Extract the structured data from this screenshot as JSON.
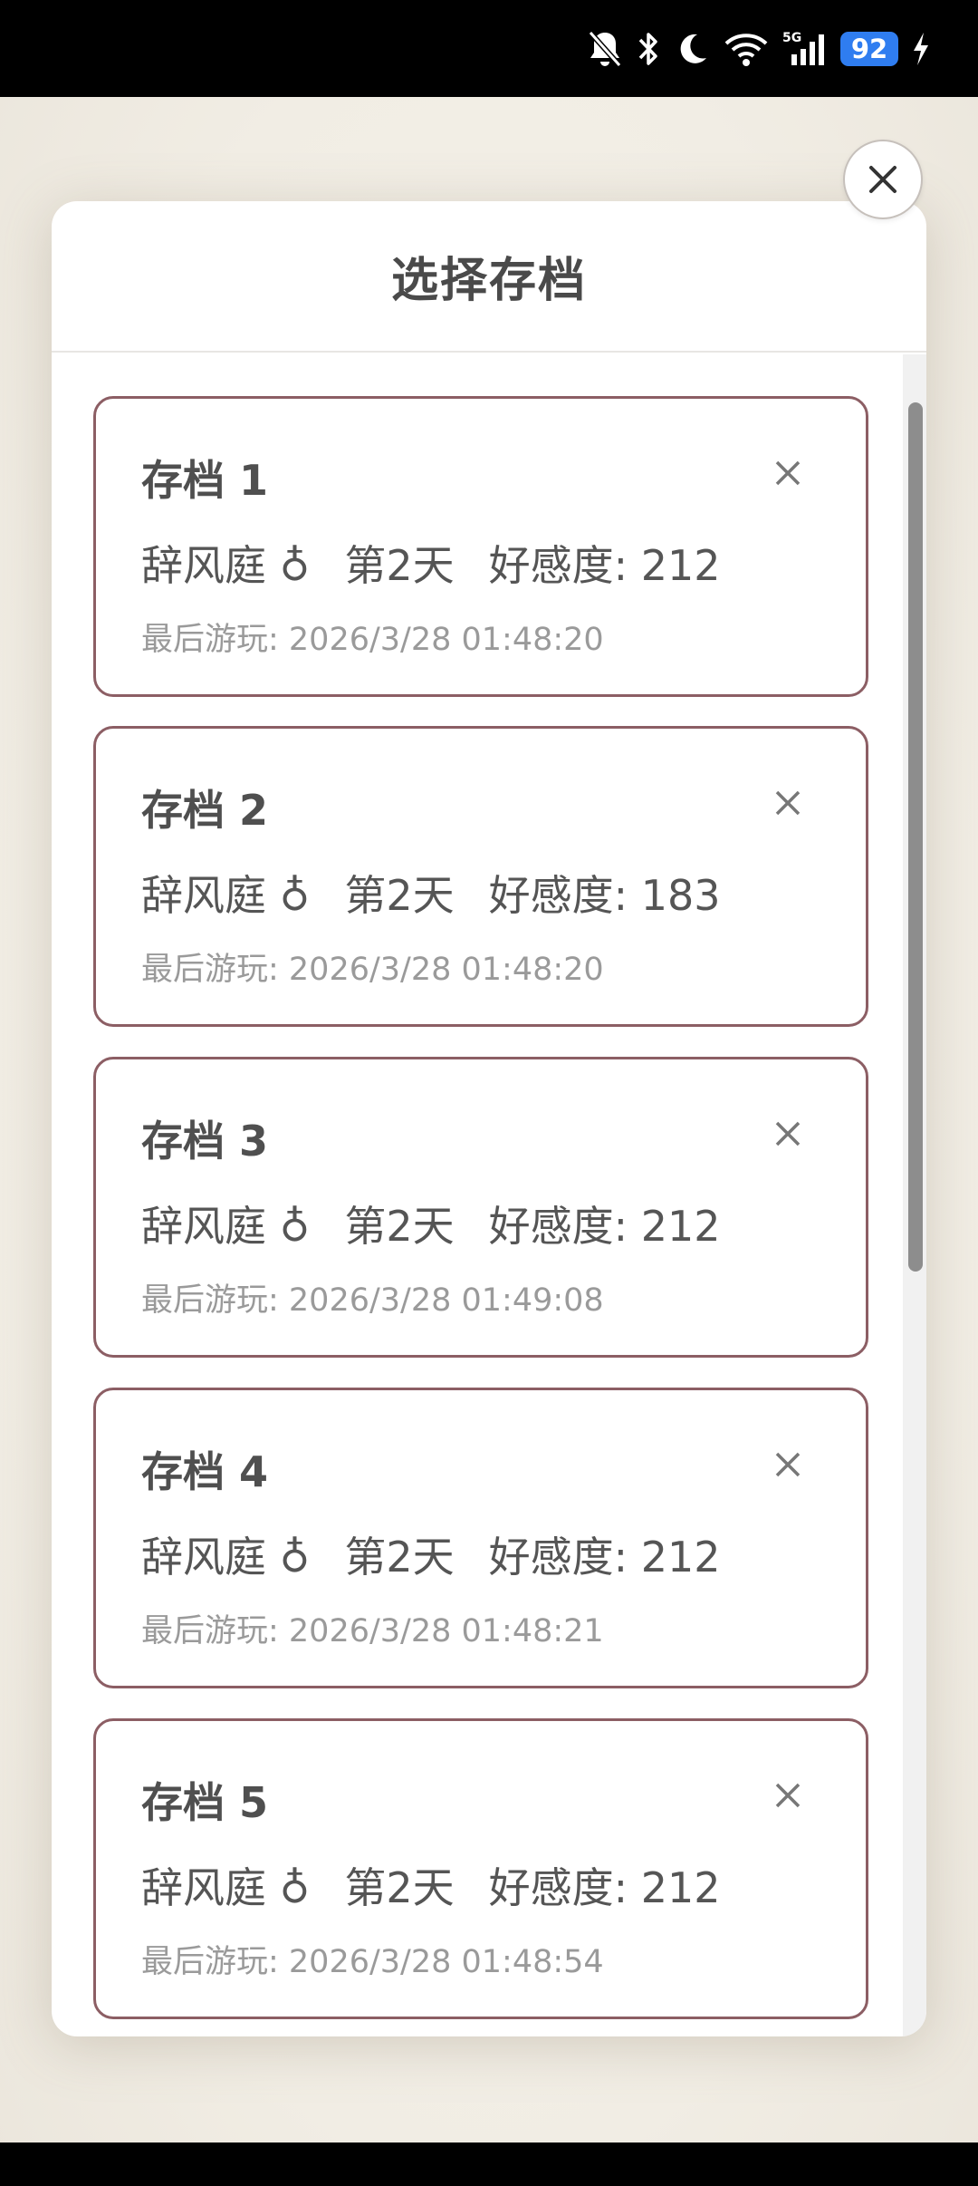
{
  "status": {
    "battery": "92",
    "icons": [
      "bell-muted-icon",
      "bluetooth-icon",
      "moon-icon",
      "wifi-icon",
      "signal-5g-icon",
      "charging-icon"
    ],
    "network_label": "5G"
  },
  "dialog": {
    "title": "选择存档",
    "close_icon": "close-icon"
  },
  "saves": [
    {
      "title": "存档 1",
      "character": "辞风庭 ♁",
      "day": "第2天",
      "affection": "好感度: 212",
      "last_played": "最后游玩: 2026/3/28 01:48:20"
    },
    {
      "title": "存档 2",
      "character": "辞风庭 ♁",
      "day": "第2天",
      "affection": "好感度: 183",
      "last_played": "最后游玩: 2026/3/28 01:48:20"
    },
    {
      "title": "存档 3",
      "character": "辞风庭 ♁",
      "day": "第2天",
      "affection": "好感度: 212",
      "last_played": "最后游玩: 2026/3/28 01:49:08"
    },
    {
      "title": "存档 4",
      "character": "辞风庭 ♁",
      "day": "第2天",
      "affection": "好感度: 212",
      "last_played": "最后游玩: 2026/3/28 01:48:21"
    },
    {
      "title": "存档 5",
      "character": "辞风庭 ♁",
      "day": "第2天",
      "affection": "好感度: 212",
      "last_played": "最后游玩: 2026/3/28 01:48:54"
    }
  ],
  "colors": {
    "slot_border": "#8c5e64",
    "battery": "#2f7df0"
  }
}
